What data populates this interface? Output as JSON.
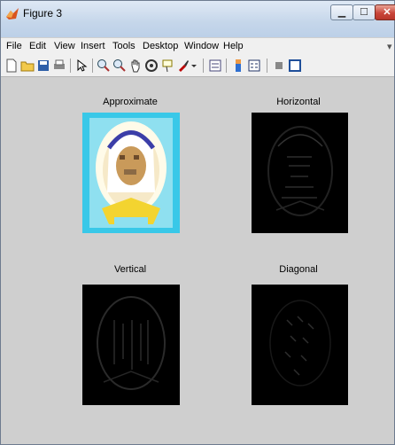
{
  "window": {
    "title": "Figure 3"
  },
  "menu": [
    "File",
    "Edit",
    "View",
    "Insert",
    "Tools",
    "Desktop",
    "Window",
    "Help"
  ],
  "toolbar": {
    "icons": [
      "new-figure-icon",
      "open-file-icon",
      "save-icon",
      "print-icon",
      "pointer-icon",
      "zoom-in-icon",
      "zoom-out-icon",
      "pan-icon",
      "rotate-3d-icon",
      "data-cursor-icon",
      "brush-icon",
      "dropdown-arrow-icon",
      "link-plot-icon",
      "insert-colorbar-icon",
      "insert-legend-icon",
      "hide-plot-tools-icon",
      "show-plot-tools-icon"
    ]
  },
  "subplots": [
    {
      "title": "Approximate"
    },
    {
      "title": "Horizontal"
    },
    {
      "title": "Vertical"
    },
    {
      "title": "Diagonal"
    }
  ]
}
